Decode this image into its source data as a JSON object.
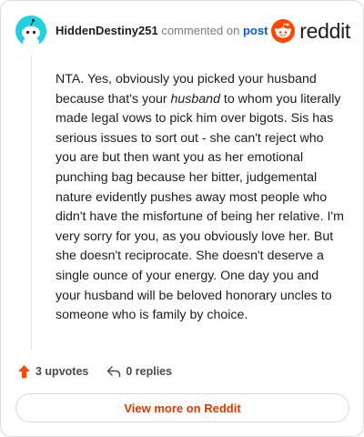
{
  "header": {
    "username": "HiddenDestiny251",
    "action_text": "commented on",
    "post_link": "post",
    "brand": "reddit"
  },
  "comment": {
    "text_before": "NTA. Yes, obviously you picked your husband because that's your ",
    "emphasis": "husband",
    "text_after": " to whom you literally made legal vows to pick him over bigots. Sis has serious issues to sort out - she can't reject who you are but then want you as her emotional punching bag because her bitter, judgemental nature evidently pushes away most people who didn't have the misfortune of being her relative. I'm very sorry for you, as you obviously love her. But she doesn't reciprocate. She doesn't deserve a single ounce of your energy. One day you and your husband will be beloved honorary uncles to someone who is family by choice."
  },
  "actions": {
    "upvotes": "3 upvotes",
    "replies": "0 replies"
  },
  "footer": {
    "view_more": "View more on Reddit"
  },
  "colors": {
    "brand_orange": "#ff4500",
    "link_blue": "#0a5bd9",
    "avatar_bg": "#24cfe0"
  },
  "icons": {
    "avatar": "snoo-avatar-icon",
    "brand": "reddit-logo-icon",
    "upvote": "upvote-arrow-icon",
    "reply": "reply-arrow-icon"
  }
}
